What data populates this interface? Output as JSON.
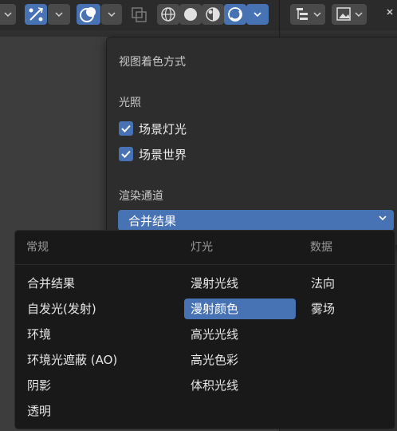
{
  "popover": {
    "title": "视图着色方式",
    "lighting_label": "光照",
    "scene_lights_label": "场景灯光",
    "scene_world_label": "场景世界",
    "render_pass_label": "渲染通道",
    "render_pass_value": "合并结果"
  },
  "menu": {
    "columns": [
      {
        "header": "常规",
        "items": [
          "合并结果",
          "自发光(发射)",
          "环境",
          "环境光遮蔽 (AO)",
          "阴影",
          "透明"
        ]
      },
      {
        "header": "灯光",
        "items": [
          "漫射光线",
          "漫射颜色",
          "高光光线",
          "高光色彩",
          "体积光线"
        ]
      },
      {
        "header": "数据",
        "items": [
          "法向",
          "雾场"
        ]
      }
    ],
    "selected_item": "漫射颜色"
  },
  "colors": {
    "accent": "#4772b3",
    "menu_bg": "#191919",
    "popover_bg": "#2d2d2d",
    "toolbar_bg": "#2b2b2b"
  },
  "toolbar_icons": [
    "gizmo-icon",
    "overlay-icon",
    "xray-icon",
    "wireframe-icon",
    "solid-icon",
    "material-preview-icon",
    "rendered-icon",
    "outliner-filter-icon",
    "image-icon"
  ]
}
